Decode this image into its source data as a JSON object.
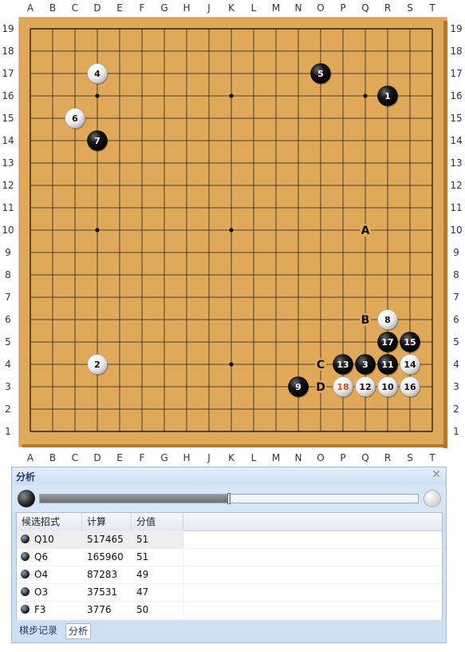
{
  "board": {
    "size": 19,
    "columns": [
      "A",
      "B",
      "C",
      "D",
      "E",
      "F",
      "G",
      "H",
      "J",
      "K",
      "L",
      "M",
      "N",
      "O",
      "P",
      "Q",
      "R",
      "S",
      "T"
    ],
    "rows": [
      "19",
      "18",
      "17",
      "16",
      "15",
      "14",
      "13",
      "12",
      "11",
      "10",
      "9",
      "8",
      "7",
      "6",
      "5",
      "4",
      "3",
      "2",
      "1"
    ],
    "colors": {
      "wood": "#e0a95a",
      "wood_edge": "#c98d3c",
      "line": "#222222",
      "last_move_number": "#d94a2a"
    },
    "star_points": [
      [
        "D",
        "16"
      ],
      [
        "K",
        "16"
      ],
      [
        "Q",
        "16"
      ],
      [
        "D",
        "10"
      ],
      [
        "K",
        "10"
      ],
      [
        "Q",
        "10"
      ],
      [
        "D",
        "4"
      ],
      [
        "K",
        "4"
      ],
      [
        "Q",
        "4"
      ]
    ],
    "stones": [
      {
        "col": "R",
        "row": "16",
        "color": "black",
        "number": "1"
      },
      {
        "col": "D",
        "row": "4",
        "color": "white",
        "number": "2"
      },
      {
        "col": "Q",
        "row": "4",
        "color": "black",
        "number": "3"
      },
      {
        "col": "D",
        "row": "17",
        "color": "white",
        "number": "4"
      },
      {
        "col": "O",
        "row": "17",
        "color": "black",
        "number": "5"
      },
      {
        "col": "C",
        "row": "15",
        "color": "white",
        "number": "6"
      },
      {
        "col": "D",
        "row": "14",
        "color": "black",
        "number": "7"
      },
      {
        "col": "R",
        "row": "6",
        "color": "white",
        "number": "8"
      },
      {
        "col": "N",
        "row": "3",
        "color": "black",
        "number": "9"
      },
      {
        "col": "R",
        "row": "3",
        "color": "white",
        "number": "10"
      },
      {
        "col": "R",
        "row": "4",
        "color": "black",
        "number": "11"
      },
      {
        "col": "Q",
        "row": "3",
        "color": "white",
        "number": "12"
      },
      {
        "col": "P",
        "row": "4",
        "color": "black",
        "number": "13"
      },
      {
        "col": "S",
        "row": "4",
        "color": "white",
        "number": "14"
      },
      {
        "col": "S",
        "row": "5",
        "color": "black",
        "number": "15"
      },
      {
        "col": "S",
        "row": "3",
        "color": "white",
        "number": "16"
      },
      {
        "col": "R",
        "row": "5",
        "color": "black",
        "number": "17"
      },
      {
        "col": "P",
        "row": "3",
        "color": "white",
        "number": "18",
        "last": true
      }
    ],
    "markers": [
      {
        "col": "Q",
        "row": "10",
        "label": "A"
      },
      {
        "col": "Q",
        "row": "6",
        "label": "B"
      },
      {
        "col": "O",
        "row": "4",
        "label": "C"
      },
      {
        "col": "O",
        "row": "3",
        "label": "D"
      }
    ]
  },
  "panel": {
    "title": "分析",
    "close_icon": "close-icon",
    "progress_fraction": 0.5,
    "columns": [
      "候选招式",
      "计算",
      "分值"
    ],
    "rows": [
      {
        "move": "Q10",
        "calc": "517465",
        "score": "51",
        "selected": true
      },
      {
        "move": "Q6",
        "calc": "165960",
        "score": "51"
      },
      {
        "move": "O4",
        "calc": "87283",
        "score": "49"
      },
      {
        "move": "O3",
        "calc": "37531",
        "score": "47"
      },
      {
        "move": "F3",
        "calc": "3776",
        "score": "50"
      }
    ],
    "tabs": [
      {
        "label": "棋步记录",
        "active": false
      },
      {
        "label": "分析",
        "active": true
      }
    ]
  }
}
